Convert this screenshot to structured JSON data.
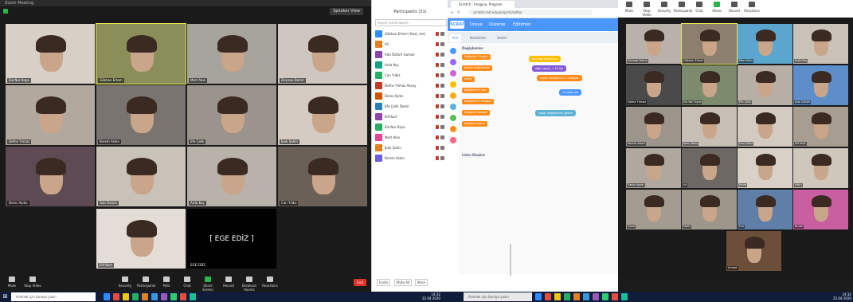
{
  "zoom": {
    "window_title": "Zoom Meeting",
    "speaker_view_label": "Speaker View",
    "participants": [
      {
        "name": "Ela Nur Kaya"
      },
      {
        "name": "Gökhan Ertem",
        "active": true
      },
      {
        "name": "Mert Akın"
      },
      {
        "name": "Zeynep Demir"
      },
      {
        "name": "Defne Yılmaz"
      },
      {
        "name": "Kerem Aslan"
      },
      {
        "name": "Efe Çelik"
      },
      {
        "name": "İpek Şahin"
      },
      {
        "name": "Deniz Aydın"
      },
      {
        "name": "Ada Öztürk"
      },
      {
        "name": "Arda Koç"
      },
      {
        "name": "Can Yıldız"
      },
      {
        "name": "Elif Kurt"
      },
      {
        "name": "EGE EDİZ",
        "video_off": true
      }
    ],
    "black_tile_label": "[ EGE EDİZ ]",
    "toolbar": {
      "mute": "Mute",
      "stop_video": "Stop Video",
      "security": "Security",
      "participants": "Participants",
      "participants_count": "31",
      "polls": "Polls",
      "chat": "Chat",
      "share_screen": "Share Screen",
      "record": "Record",
      "breakout_rooms": "Breakout Rooms",
      "reactions": "Reactions",
      "end": "End"
    }
  },
  "panel": {
    "title": "Participants (31)",
    "search_placeholder": "Search participants",
    "rows": [
      {
        "name": "Gökhan Ertem (Host, me)",
        "color": "#2d8cff"
      },
      {
        "name": "Ali",
        "color": "#e67e22"
      },
      {
        "name": "Ada Öztürk Gamze",
        "color": "#8e44ad"
      },
      {
        "name": "Arda Koç",
        "color": "#16a085"
      },
      {
        "name": "Can Yıldız",
        "color": "#27ae60"
      },
      {
        "name": "Defne Yılmaz Aksoy",
        "color": "#c0392b"
      },
      {
        "name": "Deniz Aydın",
        "color": "#d35400"
      },
      {
        "name": "Efe Çelik Demir",
        "color": "#2980b9"
      },
      {
        "name": "Elif Kurt",
        "color": "#8e44ad"
      },
      {
        "name": "Ela Nur Kaya",
        "color": "#27ae60"
      },
      {
        "name": "Mert Akın",
        "color": "#e84393"
      },
      {
        "name": "İpek Şahin",
        "color": "#e67e22"
      },
      {
        "name": "Kerem Aslan",
        "color": "#6c5ce7"
      }
    ],
    "invite": "Invite",
    "mute_all": "Mute All",
    "more": "More"
  },
  "browser": {
    "tab_title": "Scratch - Imagine, Program",
    "url": "scratch.mit.edu/projects/editor",
    "scratch": {
      "logo": "SCRATCH",
      "menu": [
        "Dosya",
        "Düzenle",
        "Eğitimler"
      ],
      "tabs": [
        "Kod",
        "Kostümler",
        "Sesler"
      ],
      "palette_title": "Değişkenler",
      "palette_blocks": [
        {
          "label": "Değişken Oluştur",
          "color": "#ff8c1a"
        },
        {
          "label": "benim değişkenim",
          "color": "#ff8c1a"
        },
        {
          "label": "sayaç",
          "color": "#ff8c1a"
        },
        {
          "label": "değişkeni 0 yap",
          "color": "#ff8c1a"
        },
        {
          "label": "değişkeni 1 değiştir",
          "color": "#ff8c1a"
        },
        {
          "label": "değişkeni göster",
          "color": "#ff8c1a"
        },
        {
          "label": "değişkeni gizle",
          "color": "#ff8c1a"
        }
      ],
      "palette_title2": "Liste Oluştur",
      "script_blocks": [
        {
          "label": "bayrağa tıklanınca",
          "color": "#ffbf00"
        },
        {
          "label": "eğer sayaç > 10 ise",
          "color": "#855cd6"
        },
        {
          "label": "sayaç değişkenini 1 değiştir",
          "color": "#ff8c1a"
        },
        {
          "label": "10 adım git",
          "color": "#4c97ff"
        },
        {
          "label": "sayaç değişkenini göster",
          "color": "#5cb1d6"
        }
      ]
    }
  },
  "gallery": {
    "toolbar": [
      "Mute",
      "Stop Video",
      "Security",
      "Participants",
      "Chat",
      "Share",
      "Record",
      "Reactions"
    ],
    "participants": [
      "Zeynep Demir",
      "Gökhan Ertem",
      "Mert Akın",
      "Arda Koç",
      "Defne Yılmaz",
      "Ela Nur Kaya",
      "Efe Çelik",
      "Ada Öztürk",
      "Kerem Aslan",
      "İpek Şahin",
      "Can Yıldız",
      "Elif Kurt",
      "Deniz Aydın",
      "Ali",
      "Emre",
      "Selin",
      "Yusuf",
      "Melis",
      "Ece",
      "Burak",
      "Ahmet"
    ]
  },
  "taskbar": {
    "search_placeholder": "Aramak için buraya yazın",
    "search_placeholder2": "Aramak için buraya yazın",
    "time": "14:32",
    "date": "22.04.2020",
    "icon_colors": [
      "#2d8cff",
      "#e74c3c",
      "#f1c40f",
      "#27ae60",
      "#e67e22",
      "#3498db",
      "#9b59b6",
      "#2ecc71",
      "#e74c3c",
      "#1abc9c"
    ]
  }
}
